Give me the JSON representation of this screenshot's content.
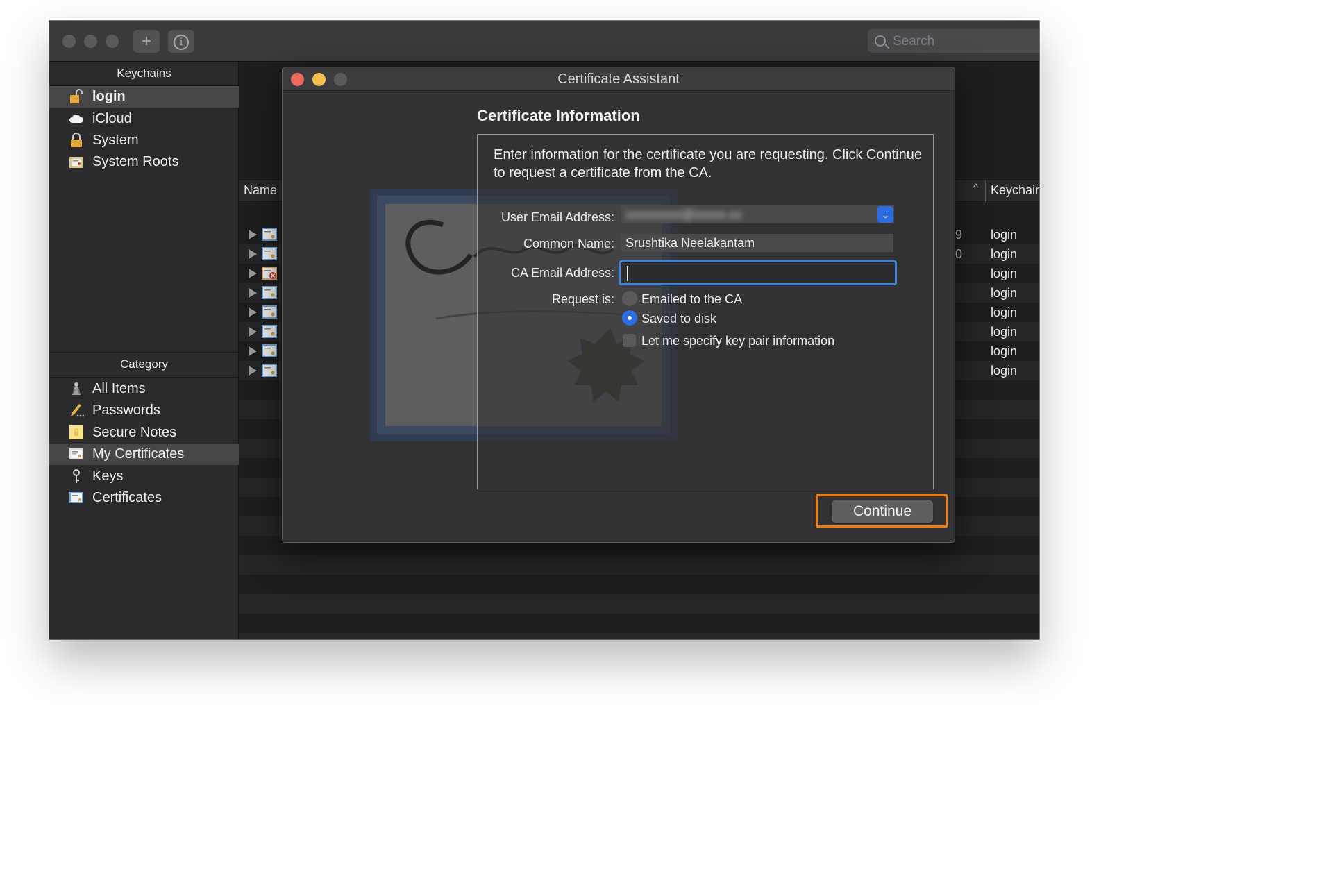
{
  "search": {
    "placeholder": "Search"
  },
  "sidebar": {
    "keychains_header": "Keychains",
    "keychains": [
      {
        "label": "login",
        "icon": "unlocked-padlock-icon",
        "selected": true
      },
      {
        "label": "iCloud",
        "icon": "cloud-icon"
      },
      {
        "label": "System",
        "icon": "locked-padlock-icon"
      },
      {
        "label": "System Roots",
        "icon": "certificate-folder-icon"
      }
    ],
    "category_header": "Category",
    "categories": [
      {
        "label": "All Items",
        "icon": "all-items-icon"
      },
      {
        "label": "Passwords",
        "icon": "pencil-icon"
      },
      {
        "label": "Secure Notes",
        "icon": "note-icon"
      },
      {
        "label": "My Certificates",
        "icon": "my-certificate-icon",
        "selected": true
      },
      {
        "label": "Keys",
        "icon": "key-icon"
      },
      {
        "label": "Certificates",
        "icon": "certificate-icon"
      }
    ]
  },
  "list": {
    "columns": {
      "name": "Name",
      "keychain": "Keychain"
    },
    "partial_values": [
      "9",
      "0"
    ],
    "rows": [
      {
        "keychain": "login",
        "icon": "certificate-icon"
      },
      {
        "keychain": "login",
        "icon": "certificate-icon"
      },
      {
        "keychain": "login",
        "icon": "invalid-certificate-icon"
      },
      {
        "keychain": "login",
        "icon": "certificate-icon"
      },
      {
        "keychain": "login",
        "icon": "certificate-icon"
      },
      {
        "keychain": "login",
        "icon": "certificate-icon"
      },
      {
        "keychain": "login",
        "icon": "certificate-icon"
      },
      {
        "keychain": "login",
        "icon": "certificate-icon"
      }
    ]
  },
  "dialog": {
    "title": "Certificate Assistant",
    "heading": "Certificate Information",
    "intro": "Enter information for the certificate you are requesting. Click Continue to request a certificate from the CA.",
    "fields": {
      "user_email_label": "User Email Address:",
      "user_email_value": "",
      "common_name_label": "Common Name:",
      "common_name_value": "Srushtika Neelakantam",
      "ca_email_label": "CA Email Address:",
      "ca_email_value": "",
      "request_label": "Request is:"
    },
    "request_options": [
      {
        "label": "Emailed to the CA",
        "selected": false
      },
      {
        "label": "Saved to disk",
        "selected": true
      }
    ],
    "checkbox_label": "Let me specify key pair information",
    "checkbox_checked": false,
    "continue_label": "Continue"
  },
  "colors": {
    "accent_blue": "#2d6be0",
    "focus_ring": "#3f82d8",
    "highlight_orange": "#f07c14",
    "close_red": "#ed6a5e",
    "minimize_yellow": "#f4bf4f"
  }
}
